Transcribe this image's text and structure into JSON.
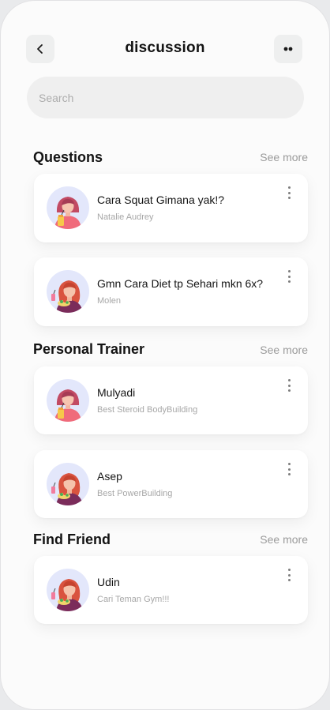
{
  "header": {
    "title": "discussion",
    "back_icon": "chevron-left-icon",
    "more_icon": "more-dots-icon"
  },
  "search": {
    "placeholder": "Search"
  },
  "sections": {
    "questions": {
      "title": "Questions",
      "see_more": "See more",
      "items": [
        {
          "title": "Cara Squat Gimana yak!?",
          "subtitle": "Natalie Audrey",
          "avatar": "woman-drink-avatar"
        },
        {
          "title": "Gmn Cara Diet tp Sehari mkn 6x?",
          "subtitle": "Molen",
          "avatar": "woman-salad-avatar"
        }
      ]
    },
    "trainers": {
      "title": "Personal Trainer",
      "see_more": "See more",
      "items": [
        {
          "title": "Mulyadi",
          "subtitle": "Best Steroid BodyBuilding",
          "avatar": "woman-drink-avatar"
        },
        {
          "title": "Asep",
          "subtitle": "Best PowerBuilding",
          "avatar": "woman-salad-avatar"
        }
      ]
    },
    "friends": {
      "title": "Find Friend",
      "see_more": "See more",
      "items": [
        {
          "title": "Udin",
          "subtitle": "Cari Teman Gym!!!",
          "avatar": "woman-salad-avatar"
        }
      ]
    }
  },
  "colors": {
    "background": "#fbfbfb",
    "card": "#ffffff",
    "avatar_bg": "#e3e7fb",
    "title_text": "#141414",
    "muted_text": "#a7a7a7",
    "search_bg": "#efefef"
  }
}
